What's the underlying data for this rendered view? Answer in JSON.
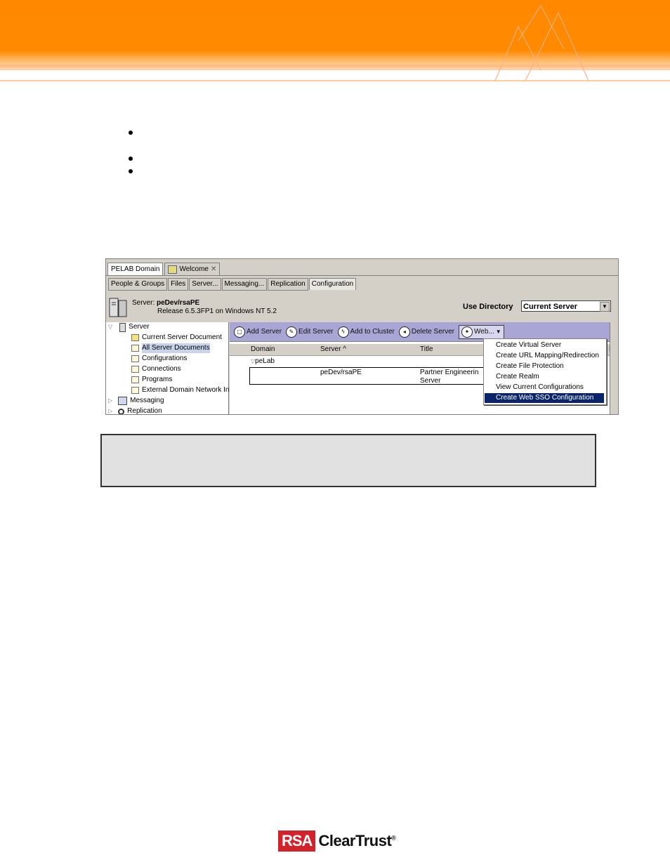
{
  "colors": {
    "banner": "#ff8a00",
    "selection": "#0a246a",
    "toolbar": "#a9a6d6",
    "logo_red": "#d2232a"
  },
  "app": {
    "top_tabs": [
      {
        "label": "PELAB Domain",
        "icon": ""
      },
      {
        "label": "Welcome",
        "icon": "welcome-icon"
      }
    ],
    "nav_tabs": [
      "People & Groups",
      "Files",
      "Server...",
      "Messaging...",
      "Replication",
      "Configuration"
    ],
    "server_prefix": "Server:",
    "server_name": "peDev/rsaPE",
    "release": "Release 6.5.3FP1 on Windows NT 5.2",
    "use_directory_label": "Use Directory",
    "use_directory_value": "Current Server",
    "tree": [
      {
        "label": "Server",
        "icon": "server-icon"
      },
      {
        "label": "Current Server Document",
        "icon": "document-icon"
      },
      {
        "label": "All Server Documents",
        "icon": "view-icon"
      },
      {
        "label": "Configurations",
        "icon": "view-icon"
      },
      {
        "label": "Connections",
        "icon": "view-icon"
      },
      {
        "label": "Programs",
        "icon": "view-icon"
      },
      {
        "label": "External Domain Network Inf",
        "icon": "view-icon"
      },
      {
        "label": "Messaging",
        "icon": "messaging-icon"
      },
      {
        "label": "Replication",
        "icon": "replication-icon"
      }
    ],
    "toolbar": {
      "add_server": "Add Server",
      "edit_server": "Edit Server",
      "add_to_cluster": "Add to Cluster",
      "delete_server": "Delete Server",
      "web": "Web..."
    },
    "grid": {
      "columns": [
        "Domain",
        "Server ^",
        "Title",
        "F"
      ],
      "group": "peLab",
      "row": {
        "server": "peDev/rsaPE",
        "title_line1": "Partner Engineerin",
        "title_line2": "Server"
      }
    },
    "web_menu": [
      "Create Virtual Server",
      "Create URL Mapping/Redirection",
      "Create File Protection",
      "Create Realm",
      "View Current Configurations",
      "Create Web SSO Configuration"
    ]
  },
  "footer": {
    "logo_rsa": "RSA",
    "logo_product": "ClearTrust",
    "logo_reg": "®"
  }
}
